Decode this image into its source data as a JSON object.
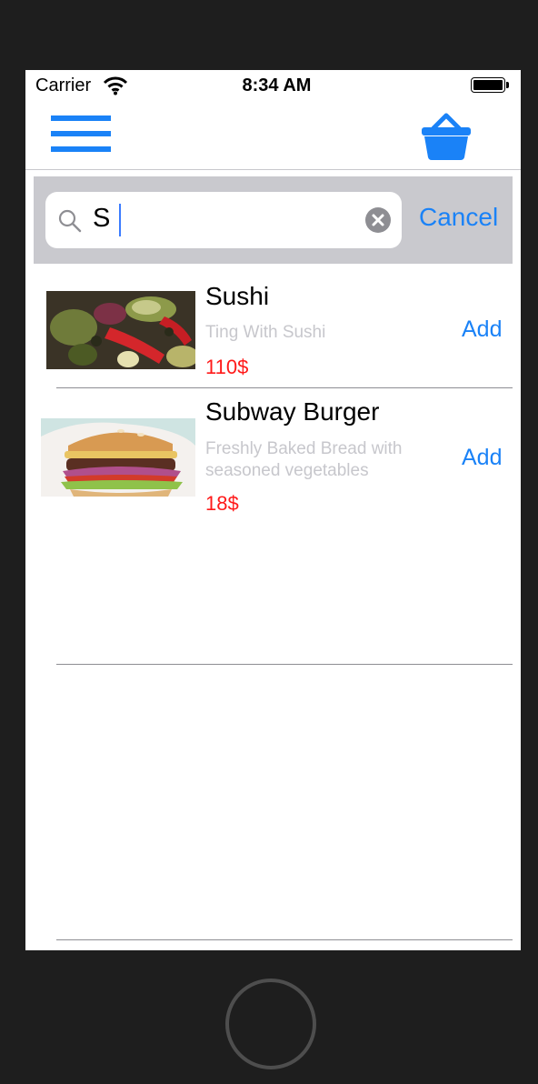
{
  "status_bar": {
    "carrier": "Carrier",
    "time": "8:34 AM"
  },
  "nav": {
    "menu_icon": "hamburger-menu-icon",
    "basket_icon": "shopping-basket-icon"
  },
  "search": {
    "value": "S",
    "cancel_label": "Cancel"
  },
  "items": [
    {
      "name": "Sushi",
      "description": "Ting With Sushi",
      "price": "110$",
      "add_label": "Add"
    },
    {
      "name": "Subway Burger",
      "description": "Freshly Baked Bread with seasoned vegetables",
      "price": "18$",
      "add_label": "Add"
    }
  ],
  "colors": {
    "accent": "#1a82f7",
    "price": "#ff1a1a",
    "search_bar_bg": "#c9c9ce",
    "device_frame": "#1e1e1e"
  }
}
